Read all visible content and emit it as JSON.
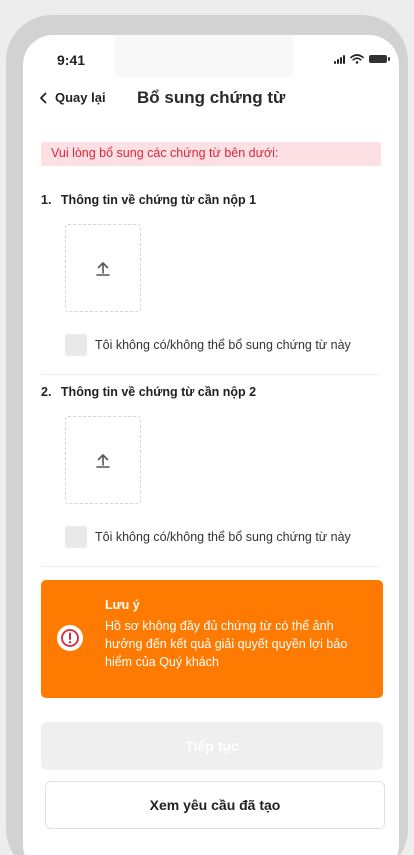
{
  "status_bar": {
    "time": "9:41"
  },
  "nav": {
    "back_label": "Quay lại",
    "title": "Bổ sung chứng từ"
  },
  "alert": {
    "text": "Vui lòng bổ sung các chứng từ bên dưới:"
  },
  "documents": [
    {
      "number": "1.",
      "title": "Thông tin về chứng từ cần nộp 1",
      "checkbox_label": "Tôi không có/không thể bổ sung chứng từ này",
      "checked": false
    },
    {
      "number": "2.",
      "title": "Thông tin về chứng từ cần nộp 2",
      "checkbox_label": "Tôi không có/không thể bổ sung chứng từ này",
      "checked": false
    }
  ],
  "note": {
    "title": "Lưu ý",
    "body": "Hồ sơ không đầy đủ chứng từ có thể ảnh hưởng đến kết quả giải quyết quyền lợi bảo hiểm của Quý khách"
  },
  "buttons": {
    "continue_label": "Tiếp tục",
    "view_requests_label": "Xem yêu cầu đã tạo"
  },
  "colors": {
    "accent_orange": "#ff7a00",
    "alert_bg": "#fde0e4",
    "alert_text": "#d8283c",
    "disabled_button": "#efefef"
  },
  "icons": {
    "back": "chevron-left-icon",
    "upload": "upload-arrow-icon",
    "warning": "exclamation-circle-icon"
  }
}
